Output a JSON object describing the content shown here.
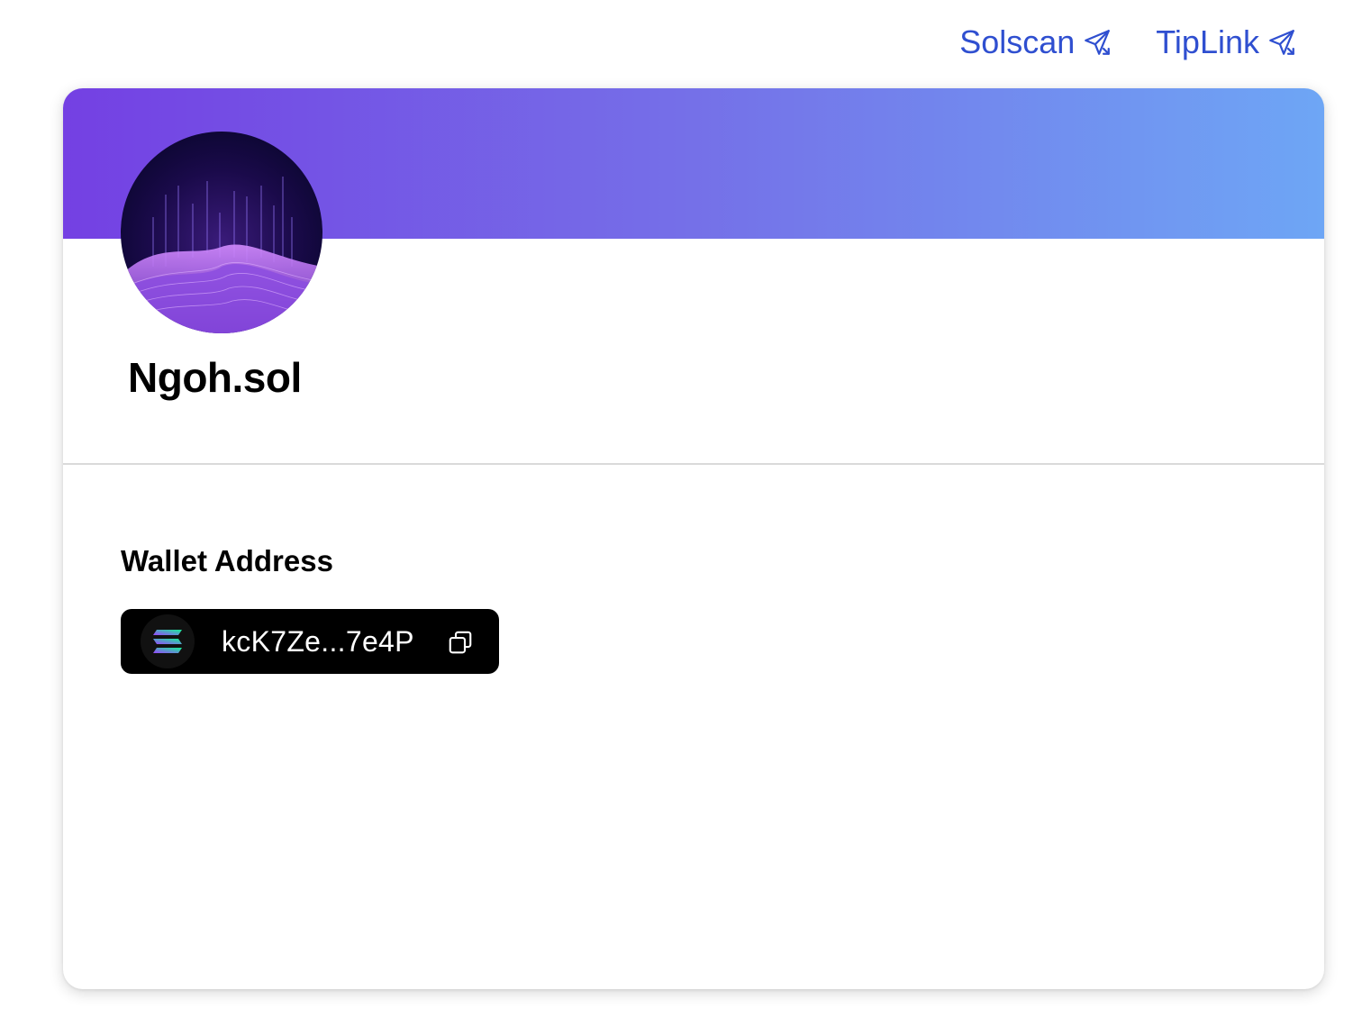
{
  "header": {
    "links": [
      {
        "label": "Solscan",
        "icon": "external-send-icon"
      },
      {
        "label": "TipLink",
        "icon": "external-send-icon"
      }
    ]
  },
  "profile": {
    "name": "Ngoh.sol",
    "avatar_alt": "profile avatar",
    "banner_colors": [
      "#7440e3",
      "#6ea6f5"
    ]
  },
  "wallet": {
    "heading": "Wallet Address",
    "address_short": "kcK7Ze...7e4P",
    "chain_icon": "solana-icon",
    "copy_icon": "copy-icon"
  },
  "colors": {
    "link": "#2f4fd0",
    "pill_bg": "#000000",
    "divider": "#dadada"
  }
}
